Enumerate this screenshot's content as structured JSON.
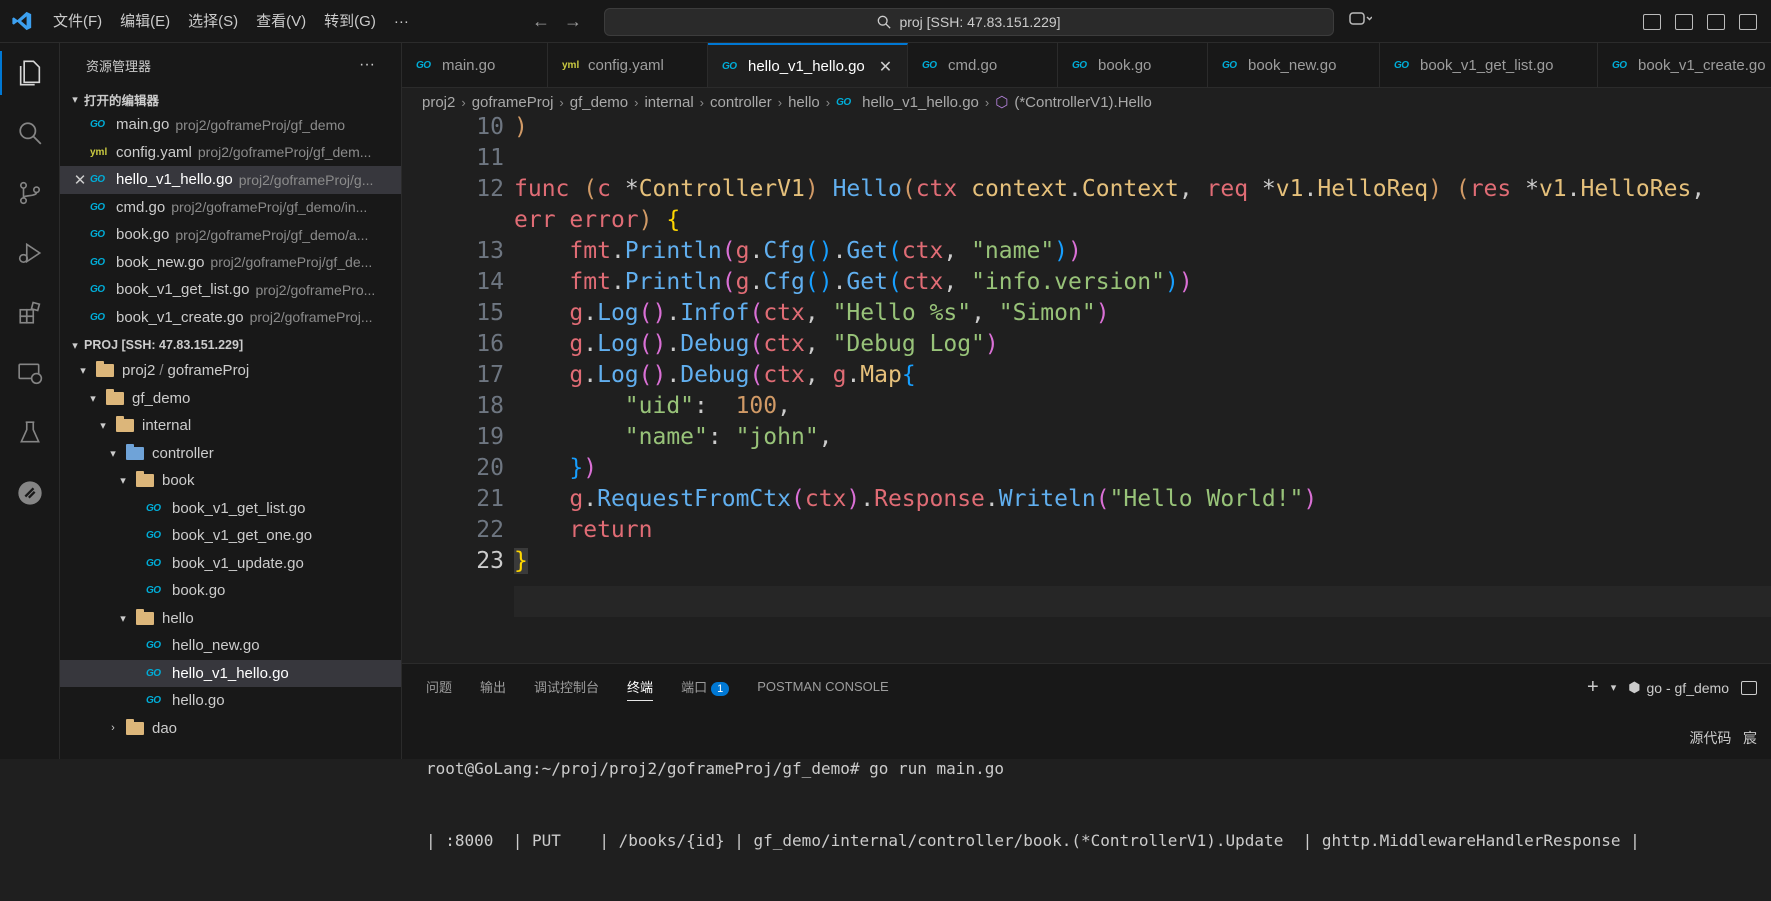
{
  "menu": [
    "文件(F)",
    "编辑(E)",
    "选择(S)",
    "查看(V)",
    "转到(G)",
    "···"
  ],
  "search": {
    "label": "proj [SSH: 47.83.151.229]"
  },
  "sidebar": {
    "title": "资源管理器",
    "open_editors_title": "打开的编辑器",
    "open_editors": [
      {
        "name": "main.go",
        "path": "proj2/goframeProj/gf_demo",
        "icon": "go"
      },
      {
        "name": "config.yaml",
        "path": "proj2/goframeProj/gf_dem...",
        "icon": "yaml"
      },
      {
        "name": "hello_v1_hello.go",
        "path": "proj2/goframeProj/g...",
        "icon": "go",
        "selected": true
      },
      {
        "name": "cmd.go",
        "path": "proj2/goframeProj/gf_demo/in...",
        "icon": "go"
      },
      {
        "name": "book.go",
        "path": "proj2/goframeProj/gf_demo/a...",
        "icon": "go"
      },
      {
        "name": "book_new.go",
        "path": "proj2/goframeProj/gf_de...",
        "icon": "go"
      },
      {
        "name": "book_v1_get_list.go",
        "path": "proj2/goframePro...",
        "icon": "go"
      },
      {
        "name": "book_v1_create.go",
        "path": "proj2/goframeProj...",
        "icon": "go"
      }
    ],
    "workspace_title": "PROJ [SSH: 47.83.151.229]",
    "tree": {
      "proj2": "proj2",
      "proj2_sep": "/",
      "goframeProj": "goframeProj",
      "gf_demo": "gf_demo",
      "internal": "internal",
      "controller": "controller",
      "book": "book",
      "book_files": [
        "book_v1_get_list.go",
        "book_v1_get_one.go",
        "book_v1_update.go",
        "book.go"
      ],
      "hello": "hello",
      "hello_files": [
        "hello_new.go",
        "hello_v1_hello.go",
        "hello.go"
      ],
      "dao": "dao"
    }
  },
  "tabs": [
    "main.go",
    "config.yaml",
    "hello_v1_hello.go",
    "cmd.go",
    "book.go",
    "book_new.go",
    "book_v1_get_list.go",
    "book_v1_create.go"
  ],
  "breadcrumb": [
    "proj2",
    "goframeProj",
    "gf_demo",
    "internal",
    "controller",
    "hello",
    "hello_v1_hello.go",
    "(*ControllerV1).Hello"
  ],
  "code": {
    "line_numbers": [
      "10",
      "11",
      "12",
      "",
      "13",
      "14",
      "15",
      "16",
      "17",
      "18",
      "19",
      "20",
      "21",
      "22",
      "23"
    ],
    "current_line": "23"
  },
  "panel": {
    "tabs": [
      "问题",
      "输出",
      "调试控制台",
      "终端",
      "端口",
      "POSTMAN CONSOLE"
    ],
    "ports_badge": "1",
    "terminal_name": "go - gf_demo",
    "source_control": "源代码",
    "extra": "宸",
    "terminal_lines": [
      "root@GoLang:~/proj/proj2/goframeProj/gf_demo# go run main.go",
      "| :8000  | PUT    | /books/{id} | gf_demo/internal/controller/book.(*ControllerV1).Update  | ghttp.MiddlewareHandlerResponse |"
    ]
  }
}
